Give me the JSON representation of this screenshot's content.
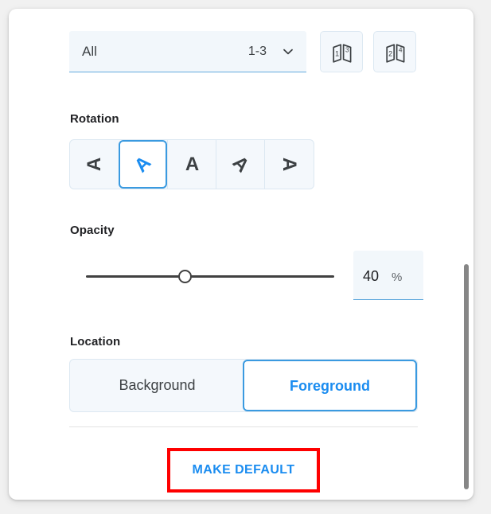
{
  "panel": {
    "page_range": {
      "label": "All",
      "value": "1-3",
      "chevron_icon": "chevron-down-icon"
    },
    "spread_buttons": [
      {
        "icon": "page-spread-1-3-icon",
        "left_number": "1",
        "right_number": "3"
      },
      {
        "icon": "page-spread-2-4-icon",
        "left_number": "2",
        "right_number": "4"
      }
    ],
    "rotation": {
      "label": "Rotation",
      "options": [
        {
          "glyph": "A",
          "angle": -90,
          "selected": false,
          "name": "rotate-minus-90"
        },
        {
          "glyph": "A",
          "angle": -45,
          "selected": true,
          "name": "rotate-minus-45"
        },
        {
          "glyph": "A",
          "angle": 0,
          "selected": false,
          "name": "rotate-0"
        },
        {
          "glyph": "A",
          "angle": 45,
          "selected": false,
          "name": "rotate-45"
        },
        {
          "glyph": "A",
          "angle": 90,
          "selected": false,
          "name": "rotate-90"
        }
      ]
    },
    "opacity": {
      "label": "Opacity",
      "value": "40",
      "unit": "%",
      "slider_percent": 40,
      "min": 0,
      "max": 100
    },
    "location": {
      "label": "Location",
      "options": [
        {
          "label": "Background",
          "selected": false
        },
        {
          "label": "Foreground",
          "selected": true
        }
      ]
    },
    "make_default_label": "MAKE DEFAULT"
  },
  "colors": {
    "accent": "#1a8cf0",
    "accent_border": "#3a9ae0",
    "field_fill": "#f2f7fb",
    "group_fill": "#f4f8fc",
    "group_border": "#dce8f2",
    "highlight_red": "#fe0000",
    "text": "#3c4043",
    "page_bg": "#f1f1f1",
    "card_bg": "#ffffff",
    "slider_track": "#414141",
    "scrollbar": "#868686"
  }
}
